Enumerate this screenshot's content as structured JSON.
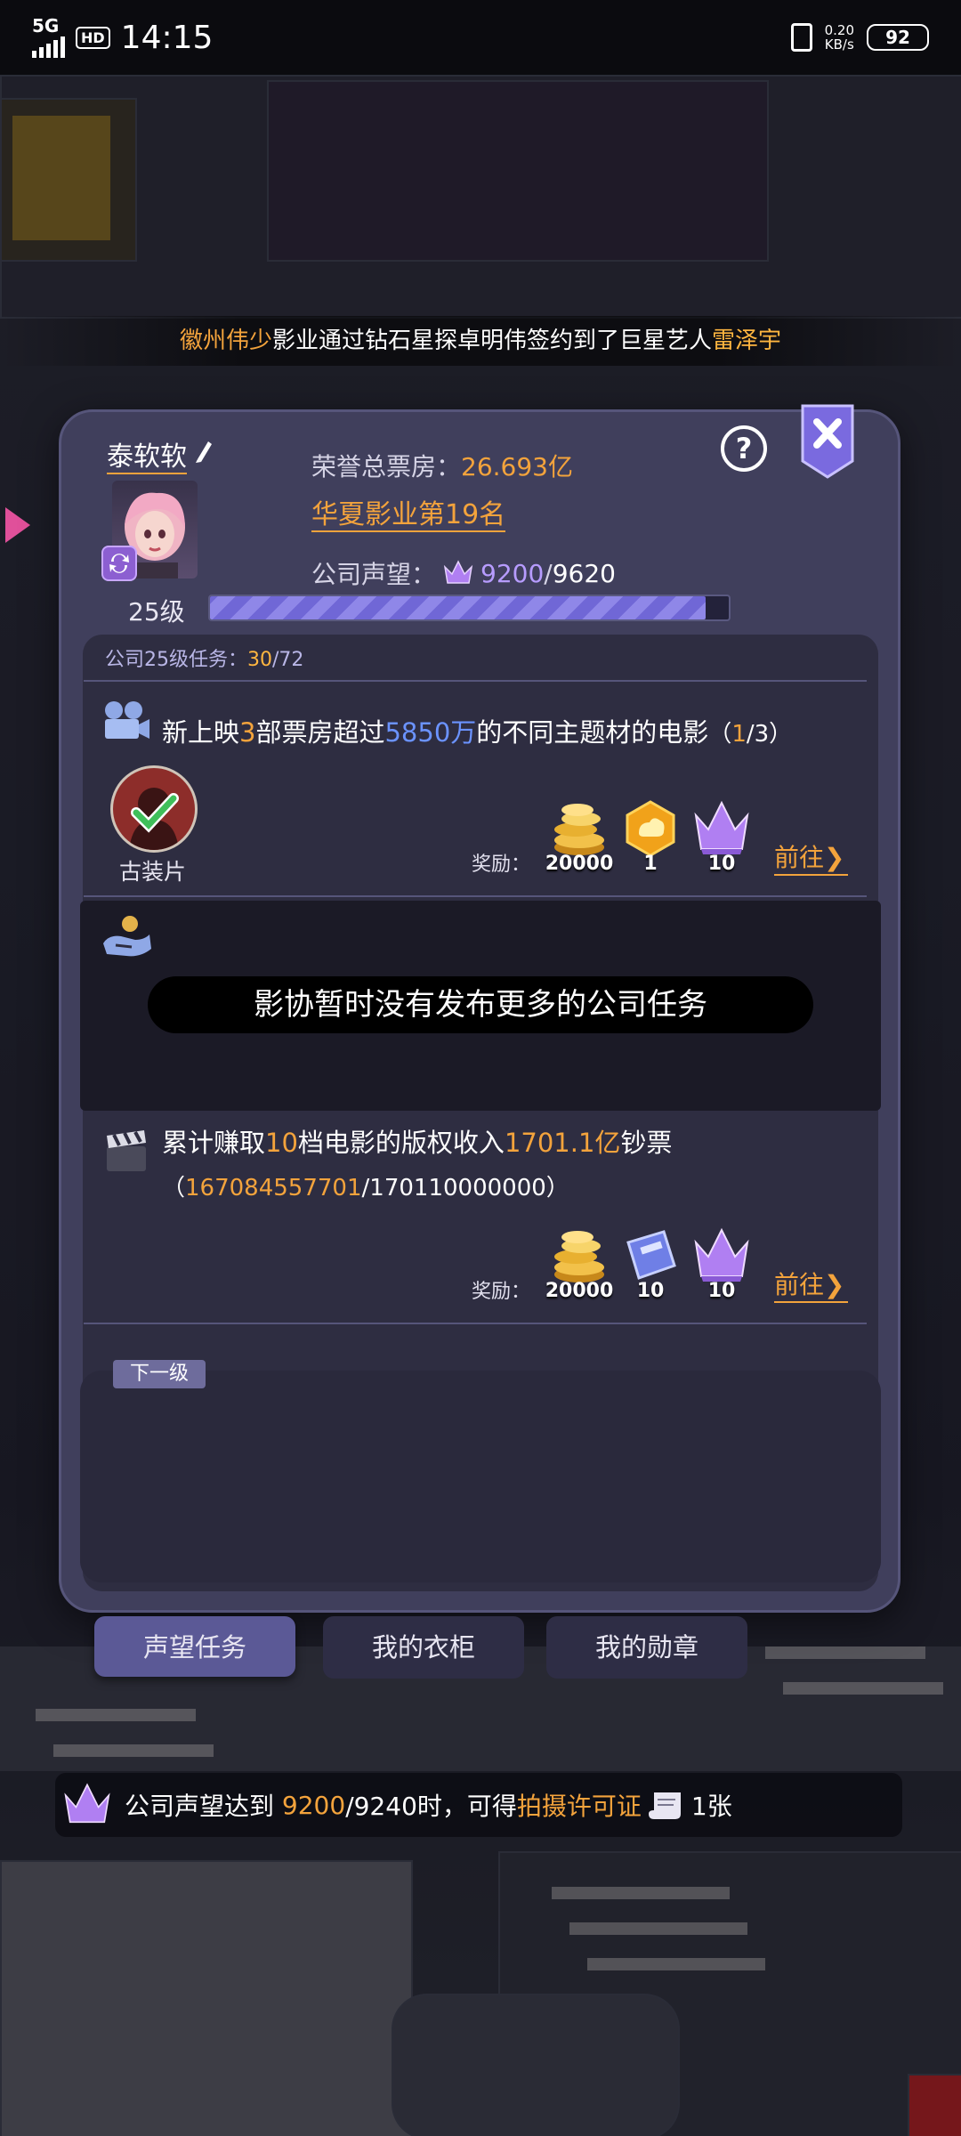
{
  "status_bar": {
    "network": "5G",
    "hd": "HD",
    "time": "14:15",
    "speed_value": "0.20",
    "speed_unit": "KB/s",
    "battery": "92"
  },
  "broadcast": {
    "part1": "徽州伟少",
    "part2": "影业通过钻石星探卓明伟签约到了巨星艺人",
    "part3": "雷泽宇"
  },
  "profile": {
    "name": "泰软软",
    "level": "25级",
    "box_office_label": "荣誉总票房：",
    "box_office_value": "26.693亿",
    "rank": "华夏影业第19名",
    "reputation_label": "公司声望：",
    "reputation_current": "9200",
    "reputation_sep": "/",
    "reputation_target": "9620",
    "reputation_progress": 0.956
  },
  "tasks": {
    "header_label": "公司25级任务：",
    "header_done": "30",
    "header_total": "/72",
    "reward_label": "奖励：",
    "goto_label": "前往",
    "task1": {
      "pre": "新上映",
      "num": "3",
      "mid": "部票房超过",
      "amount": "5850万",
      "post": "的不同主题材的电影",
      "progress_open": "（",
      "progress_done": "1",
      "progress_rest": "/3）",
      "genre": "古装片",
      "rewards": [
        {
          "icon": "gold-coins-icon",
          "count": "20000"
        },
        {
          "icon": "honor-badge-icon",
          "count": "1"
        },
        {
          "icon": "crown-icon",
          "count": "10"
        }
      ]
    },
    "locked_message": "影协暂时没有发布更多的公司任务",
    "task2": {
      "pre": "累计赚取",
      "num": "10",
      "mid": "档电影的版权收入",
      "amount": "1701.1亿",
      "post": "钞票",
      "progress_open": "（",
      "progress_done": "167084557701",
      "progress_rest": "/170110000000）",
      "rewards": [
        {
          "icon": "gold-coins-icon",
          "count": "20000"
        },
        {
          "icon": "ticket-card-icon",
          "count": "10"
        },
        {
          "icon": "crown-icon",
          "count": "10"
        }
      ]
    }
  },
  "next_level_label": "下一级",
  "tabs": [
    "声望任务",
    "我的衣柜",
    "我的勋章"
  ],
  "bottom_note": {
    "pre": "公司声望达到",
    "value": "9200",
    "target": "/9240时，可得",
    "item": "拍摄许可证",
    "count": "1张"
  },
  "colors": {
    "accent_orange": "#f3a33c",
    "accent_blue": "#6b93ff",
    "panel": "#403f5c",
    "progress": "#8f87e8"
  }
}
